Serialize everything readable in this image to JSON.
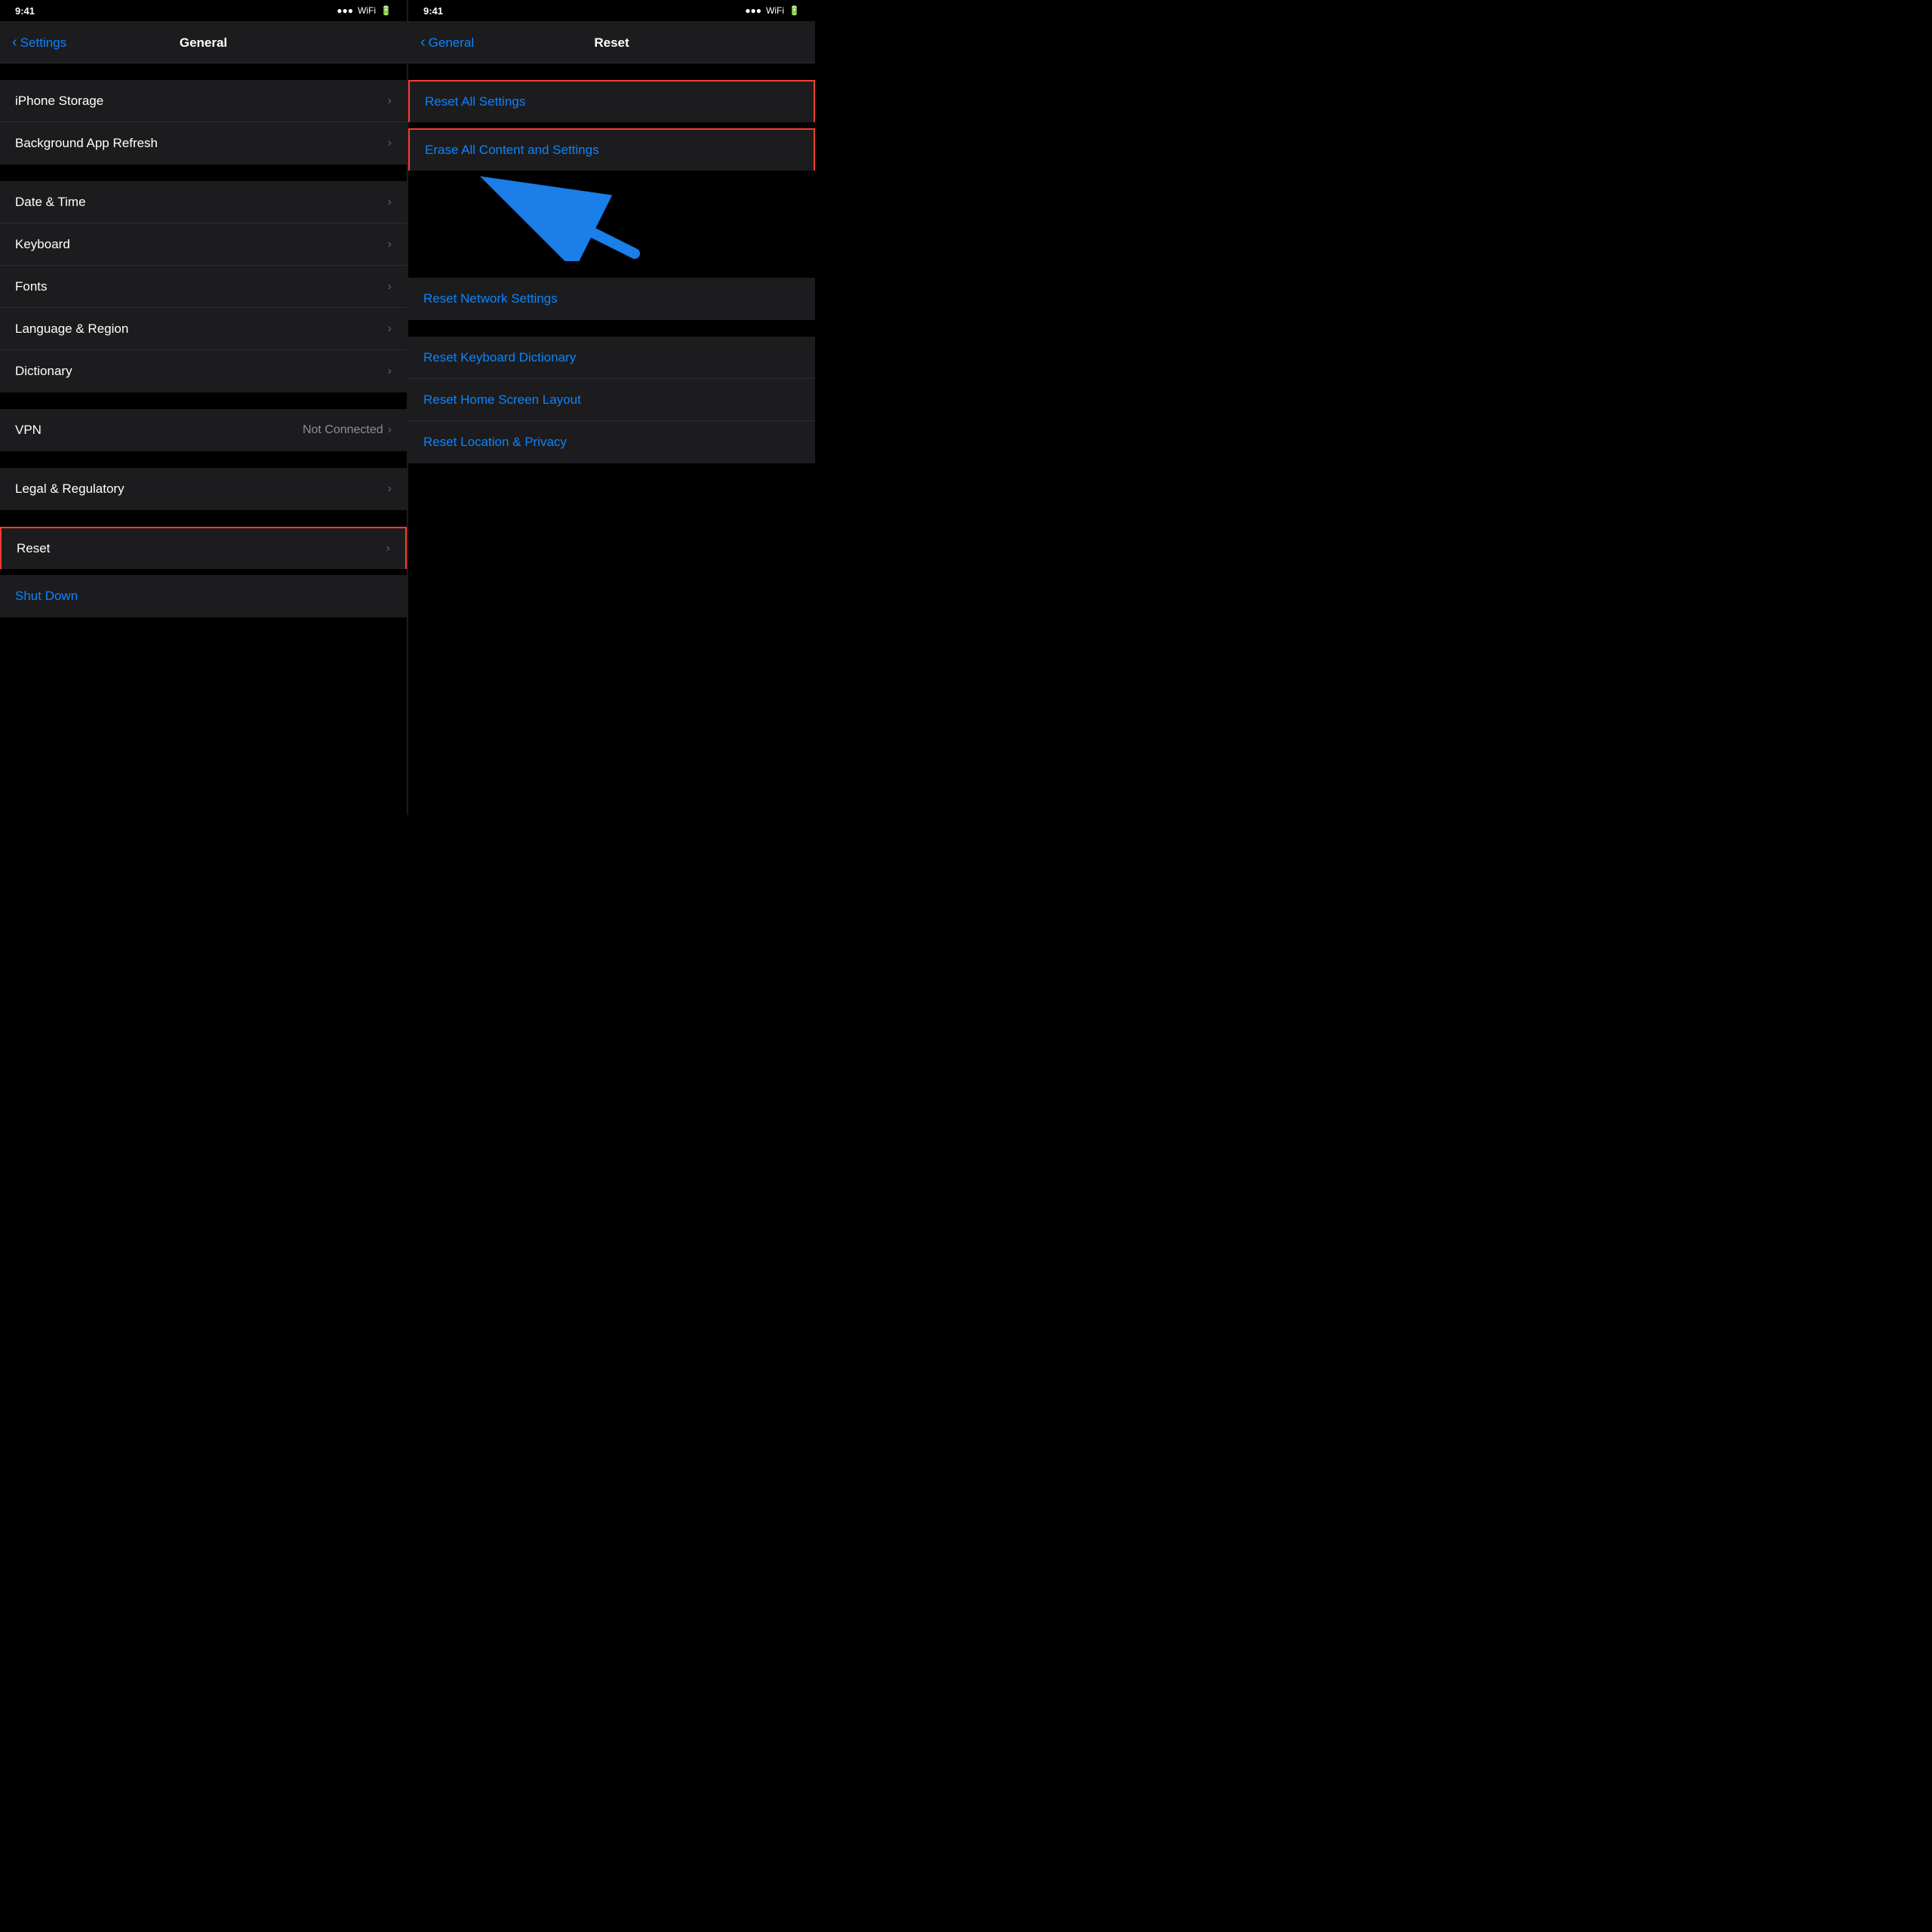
{
  "left_panel": {
    "status": {
      "time_left": "9:41",
      "time_right": "9:41"
    },
    "back_label": "Settings",
    "title": "General",
    "sections": [
      {
        "id": "storage-refresh",
        "items": [
          {
            "id": "iphone-storage",
            "label": "iPhone Storage",
            "value": "",
            "chevron": true
          },
          {
            "id": "background-refresh",
            "label": "Background App Refresh",
            "value": "",
            "chevron": true
          }
        ]
      },
      {
        "id": "datetime-keyboard",
        "items": [
          {
            "id": "date-time",
            "label": "Date & Time",
            "value": "",
            "chevron": true
          },
          {
            "id": "keyboard",
            "label": "Keyboard",
            "value": "",
            "chevron": true
          },
          {
            "id": "fonts",
            "label": "Fonts",
            "value": "",
            "chevron": true
          },
          {
            "id": "language-region",
            "label": "Language & Region",
            "value": "",
            "chevron": true
          },
          {
            "id": "dictionary",
            "label": "Dictionary",
            "value": "",
            "chevron": true
          }
        ]
      },
      {
        "id": "vpn",
        "items": [
          {
            "id": "vpn",
            "label": "VPN",
            "value": "Not Connected",
            "chevron": true
          }
        ]
      },
      {
        "id": "legal",
        "items": [
          {
            "id": "legal-regulatory",
            "label": "Legal & Regulatory",
            "value": "",
            "chevron": true
          }
        ]
      },
      {
        "id": "reset",
        "items": [
          {
            "id": "reset",
            "label": "Reset",
            "value": "",
            "chevron": true,
            "highlighted": true
          }
        ]
      }
    ],
    "shutdown_label": "Shut Down"
  },
  "right_panel": {
    "back_label": "General",
    "title": "Reset",
    "items": [
      {
        "id": "reset-all-settings",
        "label": "Reset All Settings",
        "highlighted": true,
        "outline": true
      },
      {
        "id": "erase-all",
        "label": "Erase All Content and Settings",
        "highlighted": true,
        "outline": true,
        "has_arrow": true
      },
      {
        "id": "reset-network",
        "label": "Reset Network Settings",
        "gap_before": true
      },
      {
        "id": "reset-keyboard",
        "label": "Reset Keyboard Dictionary",
        "gap_before": true
      },
      {
        "id": "reset-home-screen",
        "label": "Reset Home Screen Layout"
      },
      {
        "id": "reset-location-privacy",
        "label": "Reset Location & Privacy"
      }
    ],
    "arrow": {
      "description": "blue arrow pointing to Erase All Content and Settings"
    }
  },
  "icons": {
    "chevron": "›",
    "back_chevron": "‹",
    "wifi": "▲",
    "battery": "▮"
  }
}
